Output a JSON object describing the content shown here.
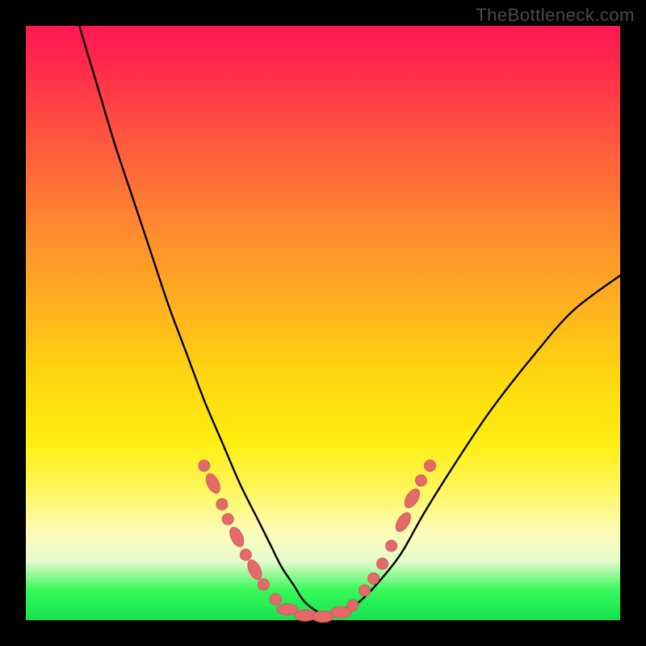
{
  "watermark": "TheBottleneck.com",
  "colors": {
    "frame": "#000000",
    "curve_stroke": "#000000",
    "marker_fill": "#e46a6a",
    "marker_stroke": "#d15a5a",
    "gradient_top": "#ff1653",
    "gradient_bottom": "#14e24e"
  },
  "chart_data": {
    "type": "line",
    "title": "",
    "xlabel": "",
    "ylabel": "",
    "xlim": [
      0,
      100
    ],
    "ylim": [
      0,
      100
    ],
    "grid": false,
    "legend": false,
    "series": [
      {
        "name": "bottleneck-curve",
        "x": [
          9,
          12,
          15,
          18,
          21,
          24,
          27,
          30,
          33,
          36,
          39,
          41,
          43,
          45,
          47,
          50,
          53,
          56,
          59,
          63,
          67,
          72,
          78,
          85,
          92,
          100
        ],
        "y": [
          100,
          90,
          80,
          71,
          62,
          53,
          45,
          37,
          30,
          23,
          17,
          13,
          9,
          6,
          3,
          1,
          1,
          3,
          6,
          11,
          18,
          26,
          35,
          44,
          52,
          58
        ]
      }
    ],
    "markers": [
      {
        "x": 30.0,
        "y": 26.0,
        "type": "dot"
      },
      {
        "x": 31.5,
        "y": 23.0,
        "type": "lozenge"
      },
      {
        "x": 33.0,
        "y": 19.5,
        "type": "dot"
      },
      {
        "x": 34.0,
        "y": 17.0,
        "type": "dot"
      },
      {
        "x": 35.5,
        "y": 14.0,
        "type": "lozenge"
      },
      {
        "x": 37.0,
        "y": 11.0,
        "type": "dot"
      },
      {
        "x": 38.5,
        "y": 8.5,
        "type": "lozenge"
      },
      {
        "x": 40.0,
        "y": 6.0,
        "type": "dot"
      },
      {
        "x": 42.0,
        "y": 3.5,
        "type": "dot"
      },
      {
        "x": 44.0,
        "y": 1.8,
        "type": "lozenge"
      },
      {
        "x": 47.0,
        "y": 0.8,
        "type": "lozenge"
      },
      {
        "x": 50.0,
        "y": 0.6,
        "type": "lozenge"
      },
      {
        "x": 53.0,
        "y": 1.3,
        "type": "lozenge"
      },
      {
        "x": 55.0,
        "y": 2.5,
        "type": "dot"
      },
      {
        "x": 57.0,
        "y": 5.0,
        "type": "dot"
      },
      {
        "x": 58.5,
        "y": 7.0,
        "type": "dot"
      },
      {
        "x": 60.0,
        "y": 9.5,
        "type": "dot"
      },
      {
        "x": 61.5,
        "y": 12.5,
        "type": "dot"
      },
      {
        "x": 63.5,
        "y": 16.5,
        "type": "lozenge"
      },
      {
        "x": 65.0,
        "y": 20.5,
        "type": "lozenge"
      },
      {
        "x": 66.5,
        "y": 23.5,
        "type": "dot"
      },
      {
        "x": 68.0,
        "y": 26.0,
        "type": "dot"
      }
    ]
  }
}
